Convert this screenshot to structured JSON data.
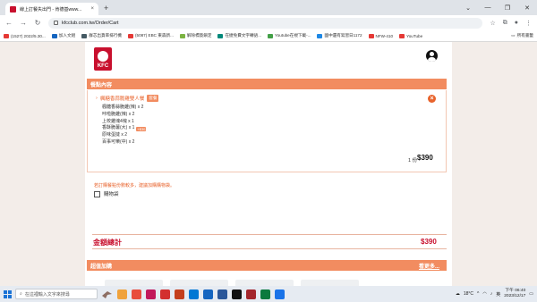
{
  "browser": {
    "tab_title": "線上訂餐失出門 - 肯德基www...",
    "tab_close": "×",
    "new_tab": "+",
    "url": "kfcclub.com.tw/Order/Cart",
    "window_controls": [
      "⌄",
      "—",
      "❐",
      "✕"
    ]
  },
  "bookmarks": [
    {
      "label": "(1527) 2022/5.30...",
      "color": "#e53935"
    },
    {
      "label": "加入文組",
      "color": "#1565c0"
    },
    {
      "label": "群芯出貨率排行機",
      "color": "#455a64"
    },
    {
      "label": "(5087) EBC 東森新...",
      "color": "#e53935"
    },
    {
      "label": "解除標簽鎖定",
      "color": "#7cb342"
    },
    {
      "label": "在捷免費文字轉語...",
      "color": "#00897b"
    },
    {
      "label": "Youtube在視下載-...",
      "color": "#43a047"
    },
    {
      "label": "國中還有寫習日1172",
      "color": "#1e88e5"
    },
    {
      "label": "NFW-410",
      "color": "#e53935"
    },
    {
      "label": "YouTube",
      "color": "#e53935"
    }
  ],
  "bookmarks_all": "所有書籤",
  "brand": {
    "logo_text": "KFC",
    "primary_color": "#c8102e",
    "accent_color": "#f28c60"
  },
  "order": {
    "section_title": "餐點內容",
    "set_name": "楓糖香蒜脆雞雙人餐",
    "set_badge": "套餐",
    "remove_icon": "×",
    "items": [
      {
        "name": "楓糖香蒜脆雞(辣) x 2"
      },
      {
        "name": "咔啦脆雞(辣) x 2"
      },
      {
        "name": "上校雞塊4塊 x 1"
      },
      {
        "name": "香酥脆薯(大) x 1",
        "upgrade": "+$30"
      },
      {
        "name": "原味蛋撻 x 2"
      },
      {
        "name": "百事可樂(中) x 2"
      }
    ],
    "quantity": "1 份",
    "price": "$390",
    "note": "若訂購餐點份數較多，建議加購購物袋。",
    "bag_label": "購物袋"
  },
  "total": {
    "label": "金額總計",
    "value": "$390"
  },
  "addons": {
    "section_title": "超值加購",
    "see_more": "看更多..."
  },
  "taskbar": {
    "search_placeholder": "在這裡輸入文字來搜尋",
    "apps": [
      "#f0a23c",
      "#e84c3d",
      "#c2185b",
      "#d32f2f",
      "#c43e1c",
      "#0078d4",
      "#1565c0",
      "#2b579a",
      "#111111",
      "#a4262c",
      "#0b7a3e",
      "#1a73e8"
    ],
    "weather": "18°C",
    "ime": "英",
    "time": "下午 06:40",
    "date": "2023/12/17"
  }
}
